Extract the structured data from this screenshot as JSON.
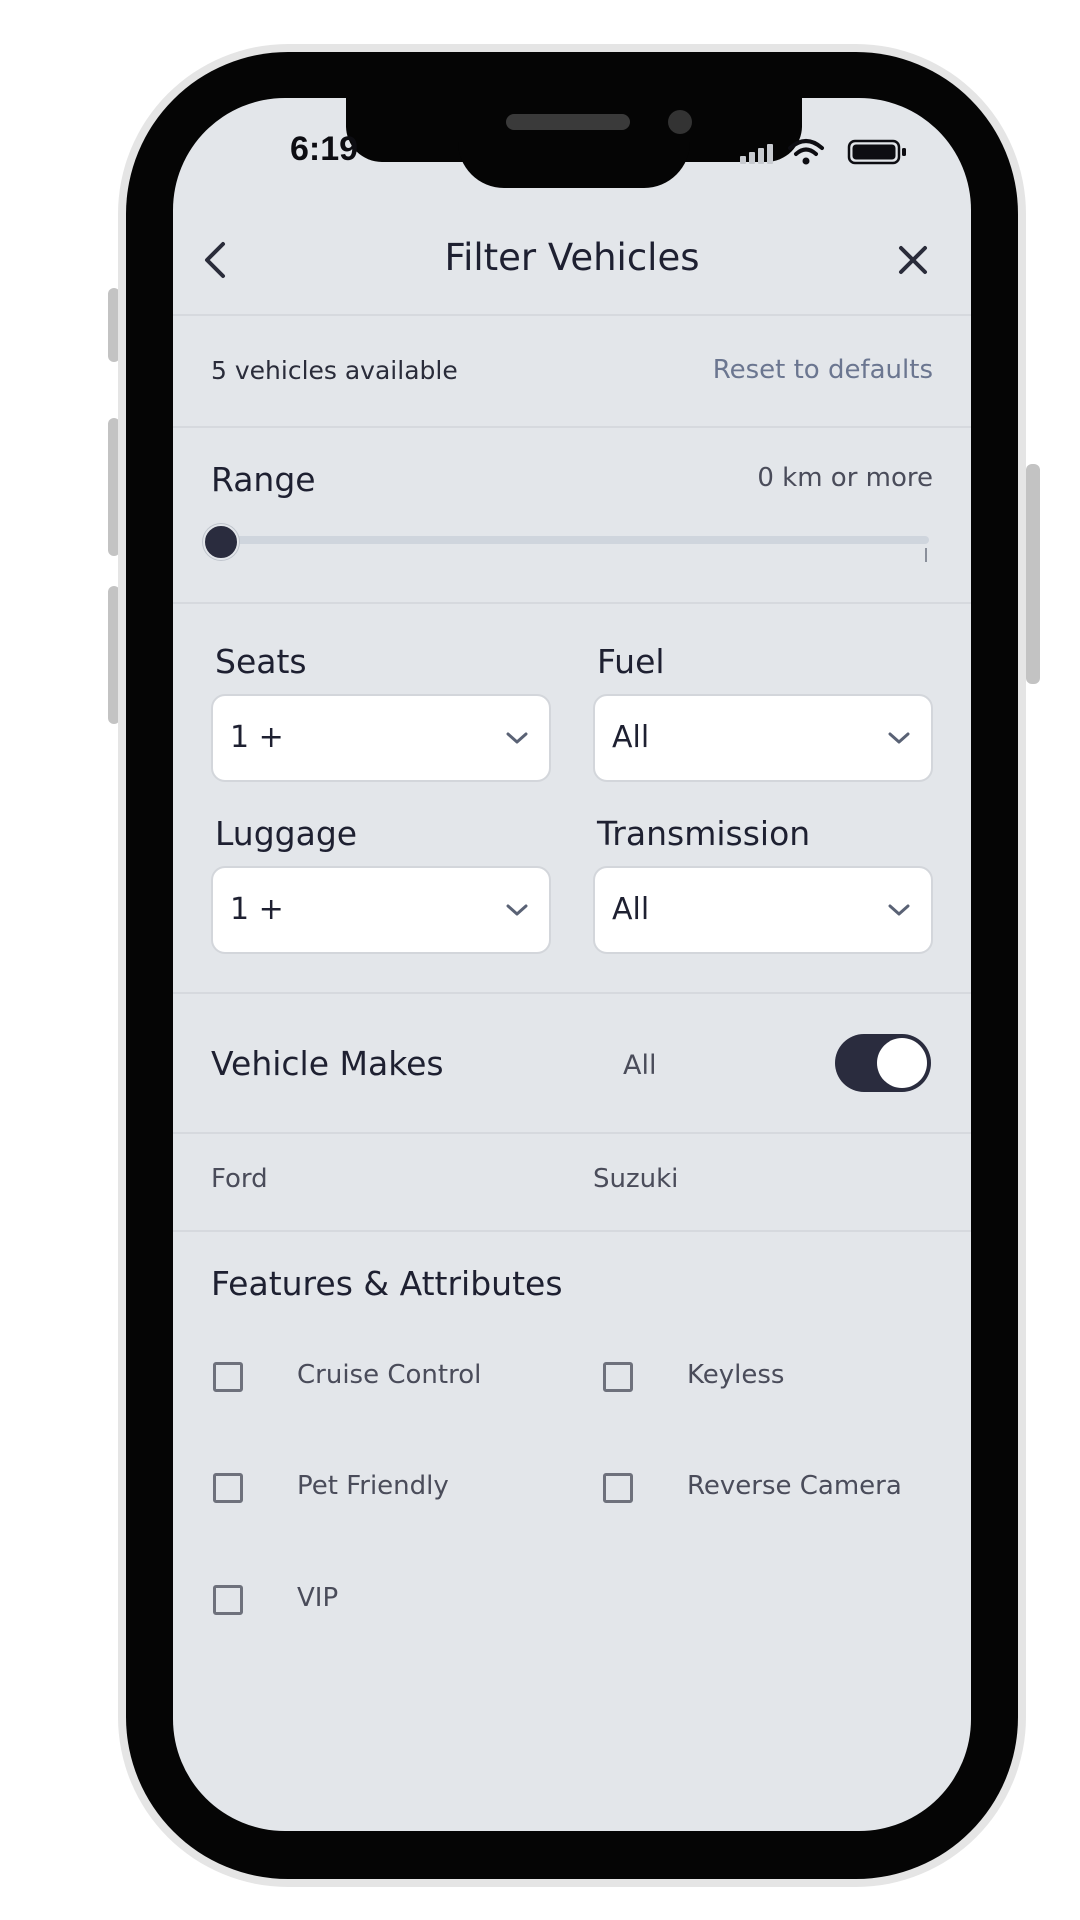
{
  "status_bar": {
    "time": "6:19"
  },
  "header": {
    "title": "Filter Vehicles",
    "back_icon": "chevron-left-icon",
    "close_icon": "close-icon"
  },
  "summary": {
    "count_text": "5 vehicles available",
    "reset_label": "Reset to defaults"
  },
  "range": {
    "title": "Range",
    "value_text": "0 km or more",
    "slider_fraction": 0
  },
  "filters": {
    "seats": {
      "label": "Seats",
      "value": "1 +"
    },
    "fuel": {
      "label": "Fuel",
      "value": "All"
    },
    "luggage": {
      "label": "Luggage",
      "value": "1 +"
    },
    "transmission": {
      "label": "Transmission",
      "value": "All"
    }
  },
  "makes": {
    "title": "Vehicle Makes",
    "all_label": "All",
    "all_enabled": true,
    "items": [
      "Ford",
      "Suzuki"
    ]
  },
  "features": {
    "title": "Features & Attributes",
    "items": [
      {
        "label": "Cruise Control",
        "checked": false
      },
      {
        "label": "Keyless",
        "checked": false
      },
      {
        "label": "Pet Friendly",
        "checked": false
      },
      {
        "label": "Reverse Camera",
        "checked": false
      },
      {
        "label": "VIP",
        "checked": false
      }
    ]
  },
  "colors": {
    "background": "#e3e6ea",
    "accent": "#2a2c3e",
    "muted_link": "#6b7690"
  }
}
